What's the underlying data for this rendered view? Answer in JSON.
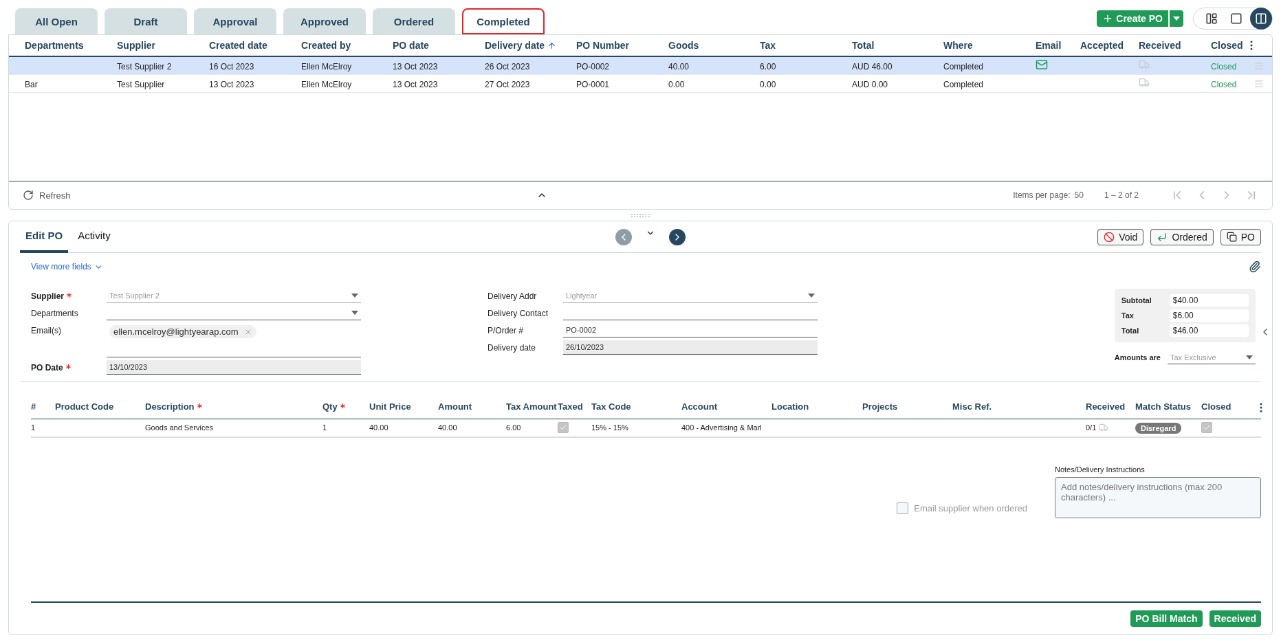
{
  "tabs": [
    {
      "label": "All Open",
      "selected": false
    },
    {
      "label": "Draft",
      "selected": false
    },
    {
      "label": "Approval",
      "selected": false
    },
    {
      "label": "Approved",
      "selected": false
    },
    {
      "label": "Ordered",
      "selected": false
    },
    {
      "label": "Completed",
      "selected": true
    }
  ],
  "create_button": "Create PO",
  "view_modes": [
    {
      "selected": false
    },
    {
      "selected": false
    },
    {
      "selected": true
    }
  ],
  "table": {
    "columns": [
      {
        "label": "Departments",
        "sorted": false
      },
      {
        "label": "Supplier",
        "sorted": false
      },
      {
        "label": "Created date",
        "sorted": false
      },
      {
        "label": "Created by",
        "sorted": false
      },
      {
        "label": "PO date",
        "sorted": false
      },
      {
        "label": "Delivery date",
        "sorted": true
      },
      {
        "label": "PO Number",
        "sorted": false
      },
      {
        "label": "Goods",
        "sorted": false
      },
      {
        "label": "Tax",
        "sorted": false
      },
      {
        "label": "Total",
        "sorted": false
      },
      {
        "label": "Where",
        "sorted": false
      },
      {
        "label": "Email",
        "sorted": false
      },
      {
        "label": "Accepted",
        "sorted": false
      },
      {
        "label": "Received",
        "sorted": false
      },
      {
        "label": "Closed",
        "sorted": false
      }
    ],
    "rows": [
      {
        "selected": true,
        "supplier": "Test Supplier 2",
        "created_date": "16 Oct 2023",
        "created_by": "Ellen McElroy",
        "po_date": "13 Oct 2023",
        "delivery_date": "26 Oct 2023",
        "po_number": "PO-0002",
        "goods": "40.00",
        "tax": "6.00",
        "total": "AUD 46.00",
        "where": "Completed",
        "email_sent": true,
        "closed": "Closed"
      },
      {
        "selected": false,
        "departments": "Bar",
        "supplier": "Test Supplier",
        "created_date": "13 Oct 2023",
        "created_by": "Ellen McElroy",
        "po_date": "13 Oct 2023",
        "delivery_date": "27 Oct 2023",
        "po_number": "PO-0001",
        "goods": "0.00",
        "tax": "0.00",
        "total": "AUD 0.00",
        "where": "Completed",
        "email_sent": false,
        "closed": "Closed"
      }
    ]
  },
  "footer": {
    "refresh": "Refresh",
    "items_per_page_label": "Items per page:",
    "items_per_page": "50",
    "range": "1 – 2 of 2"
  },
  "editor": {
    "tabs": [
      {
        "label": "Edit PO",
        "selected": true
      },
      {
        "label": "Activity",
        "selected": false
      }
    ],
    "actions": [
      {
        "kind": "void",
        "label": "Void"
      },
      {
        "kind": "ordered",
        "label": "Ordered"
      },
      {
        "kind": "copy",
        "label": "PO"
      }
    ],
    "view_more": "View more fields",
    "left_fields": [
      {
        "kind": "select",
        "label": "Supplier",
        "required": true,
        "value": "Test Supplier 2",
        "disabled": true,
        "readonly": false
      },
      {
        "kind": "select",
        "label": "Departments",
        "required": false,
        "disabled": false,
        "readonly": false
      },
      {
        "kind": "chips",
        "label": "Email(s)",
        "required": false,
        "chips": [
          "ellen.mcelroy@lightyearap.com"
        ],
        "disabled": false,
        "readonly": false
      },
      {
        "kind": "text",
        "label": "PO Date",
        "required": true,
        "value": "13/10/2023",
        "disabled": false,
        "readonly": true
      }
    ],
    "right_fields": [
      {
        "kind": "select",
        "label": "Delivery Addr",
        "required": false,
        "value": "Lightyear",
        "disabled": true,
        "readonly": false
      },
      {
        "kind": "text",
        "label": "Delivery Contact",
        "required": false,
        "disabled": false,
        "readonly": false
      },
      {
        "kind": "text",
        "label": "P/Order #",
        "required": false,
        "value": "PO-0002",
        "disabled": false,
        "readonly": false
      },
      {
        "kind": "text",
        "label": "Delivery date",
        "required": false,
        "value": "26/10/2023",
        "disabled": false,
        "readonly": true
      }
    ],
    "totals": [
      {
        "label": "Subtotal",
        "value": "$40.00"
      },
      {
        "label": "Tax",
        "value": "$6.00"
      },
      {
        "label": "Total",
        "value": "$46.00"
      }
    ],
    "amounts_are": {
      "label": "Amounts are",
      "value": "Tax Exclusive",
      "disabled": true
    },
    "lines": {
      "columns": [
        {
          "label": "#",
          "required": false
        },
        {
          "label": "Product Code",
          "required": false
        },
        {
          "label": "Description",
          "required": true
        },
        {
          "label": "Qty",
          "required": true
        },
        {
          "label": "Unit Price",
          "required": false
        },
        {
          "label": "Amount",
          "required": false
        },
        {
          "label": "Tax Amount",
          "required": false
        },
        {
          "label": "Taxed",
          "required": false
        },
        {
          "label": "Tax Code",
          "required": false
        },
        {
          "label": "Account",
          "required": false
        },
        {
          "label": "Location",
          "required": false
        },
        {
          "label": "Projects",
          "required": false
        },
        {
          "label": "Misc Ref.",
          "required": false
        },
        {
          "label": "Received",
          "required": false
        },
        {
          "label": "Match Status",
          "required": false
        },
        {
          "label": "Closed",
          "required": false
        }
      ],
      "rows": [
        {
          "number": "1",
          "description": "Goods and Services",
          "qty": "1",
          "unit_price": "40.00",
          "amount": "40.00",
          "tax_amount": "6.00",
          "taxed": true,
          "tax_code": "15% - 15%",
          "account": "400 - Advertising & Marl",
          "received": "0/1",
          "match_status": "Disregard",
          "closed": true
        }
      ]
    },
    "notes": {
      "label": "Notes/Delivery Instructions",
      "placeholder": "Add notes/delivery instructions (max 200 characters) ..."
    },
    "email_supplier": {
      "label": "Email supplier when ordered",
      "checked": false
    },
    "bottom_buttons": [
      "PO Bill Match",
      "Received"
    ]
  }
}
